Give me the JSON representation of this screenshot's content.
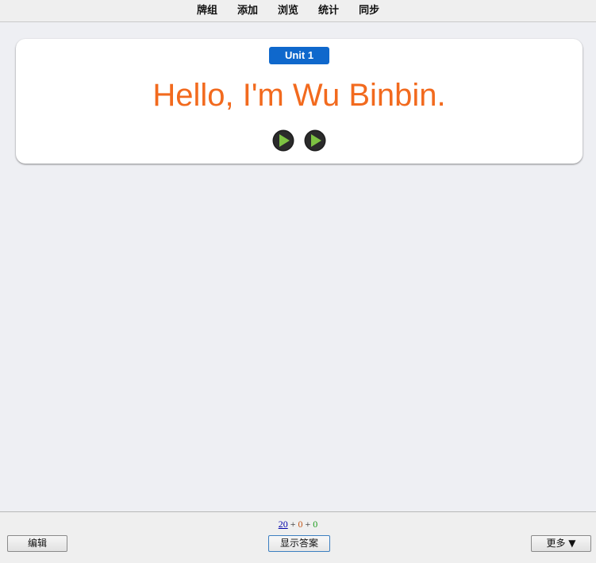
{
  "topbar": {
    "menu": [
      "牌组",
      "添加",
      "浏览",
      "统计",
      "同步"
    ]
  },
  "card": {
    "deck_tag": "Unit 1",
    "question": "Hello, I'm Wu Binbin.",
    "audio_buttons": [
      "play-icon",
      "play-icon"
    ]
  },
  "bottombar": {
    "counts": {
      "new": "20",
      "learn": "0",
      "review": "0",
      "separator": "+"
    },
    "edit_label": "编辑",
    "show_answer_label": "显示答案",
    "more_label": "更多 ▼"
  },
  "colors": {
    "background": "#eeeff3",
    "deck_tag": "#0f68cc",
    "question_text": "#f26a1e",
    "play_green": "#7dc242"
  }
}
